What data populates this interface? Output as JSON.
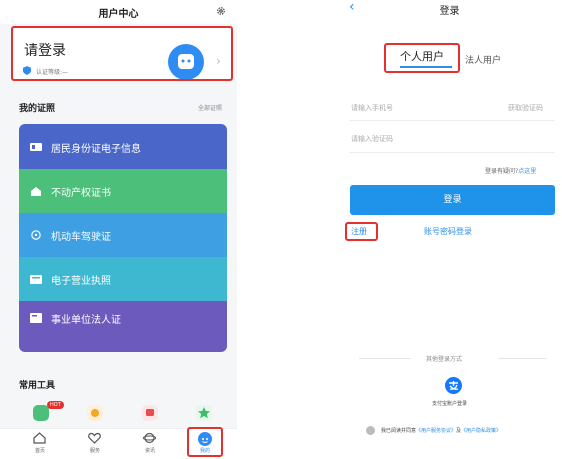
{
  "left": {
    "header_title": "用户中心",
    "login": {
      "title": "请登录",
      "cert_level": "认证等级:—"
    },
    "certs": {
      "title": "我的证照",
      "all_link": "全部证照",
      "items": [
        {
          "label": "居民身份证电子信息",
          "icon": "id-card-icon",
          "color": "#4a66c9"
        },
        {
          "label": "不动产权证书",
          "icon": "house-icon",
          "color": "#4cbf7a"
        },
        {
          "label": "机动车驾驶证",
          "icon": "steering-wheel-icon",
          "color": "#3e9fe3"
        },
        {
          "label": "电子营业执照",
          "icon": "license-icon",
          "color": "#3db8d0"
        },
        {
          "label": "事业单位法人证",
          "icon": "certificate-icon",
          "color": "#6c5bbd"
        }
      ]
    },
    "tools": {
      "title": "常用工具",
      "hot_badge": "HOT"
    },
    "tabbar": {
      "home": "首页",
      "service": "服务",
      "news": "资讯",
      "mine": "我的"
    }
  },
  "right": {
    "title": "登录",
    "tab_personal": "个人用户",
    "tab_legal": "法人用户",
    "phone_placeholder": "请输入手机号",
    "get_code": "获取验证码",
    "code_placeholder": "请输入验证码",
    "trouble_prefix": "登录有疑问?",
    "trouble_link": "点这里",
    "login_button": "登录",
    "register": "注册",
    "password_login": "账号密码登录",
    "other_methods": "其他登录方式",
    "alipay_label": "支付宝账户登录",
    "agree_text": "我已阅读并同意",
    "agreement1": "《用户服务协议》",
    "and": "及",
    "agreement2": "《用户隐私政策》"
  }
}
